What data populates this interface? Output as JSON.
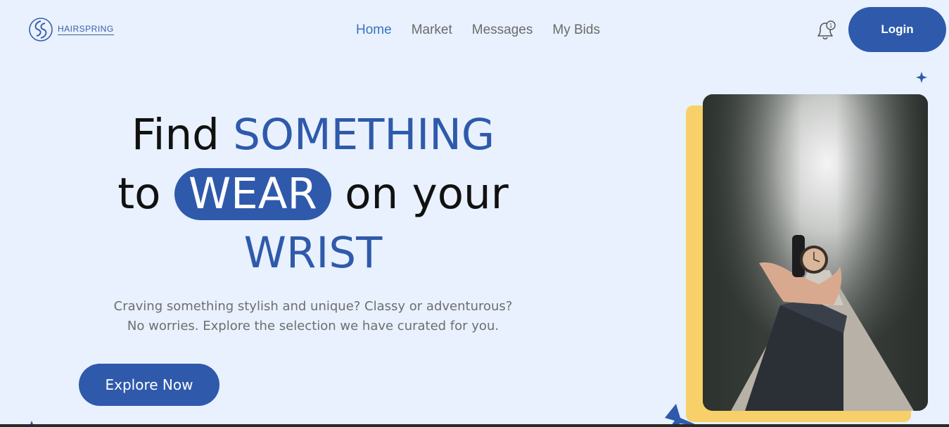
{
  "brand": {
    "name": "HAIRSPRING",
    "logo_icon": "hairspring-logo-icon"
  },
  "nav": {
    "items": [
      {
        "label": "Home",
        "active": true
      },
      {
        "label": "Market",
        "active": false
      },
      {
        "label": "Messages",
        "active": false
      },
      {
        "label": "My Bids",
        "active": false
      }
    ]
  },
  "notifications": {
    "icon": "bell-icon",
    "count": "1"
  },
  "header": {
    "login_label": "Login"
  },
  "hero": {
    "line1_plain": "Find ",
    "line1_accent": "SOMETHING",
    "line2_plain_a": "to ",
    "line2_pill": "WEAR",
    "line2_plain_b": " on your",
    "line3_accent": "WRIST",
    "subtitle": "Craving something stylish and unique? Classy or adventurous? No worries. Explore the selection we have curated for you.",
    "cta_label": "Explore Now"
  },
  "colors": {
    "background": "#e8f1fd",
    "primary": "#2f5aab",
    "active_nav": "#3a72c4",
    "accent_yellow": "#f7d06a",
    "muted_text": "#6e6e6e"
  }
}
